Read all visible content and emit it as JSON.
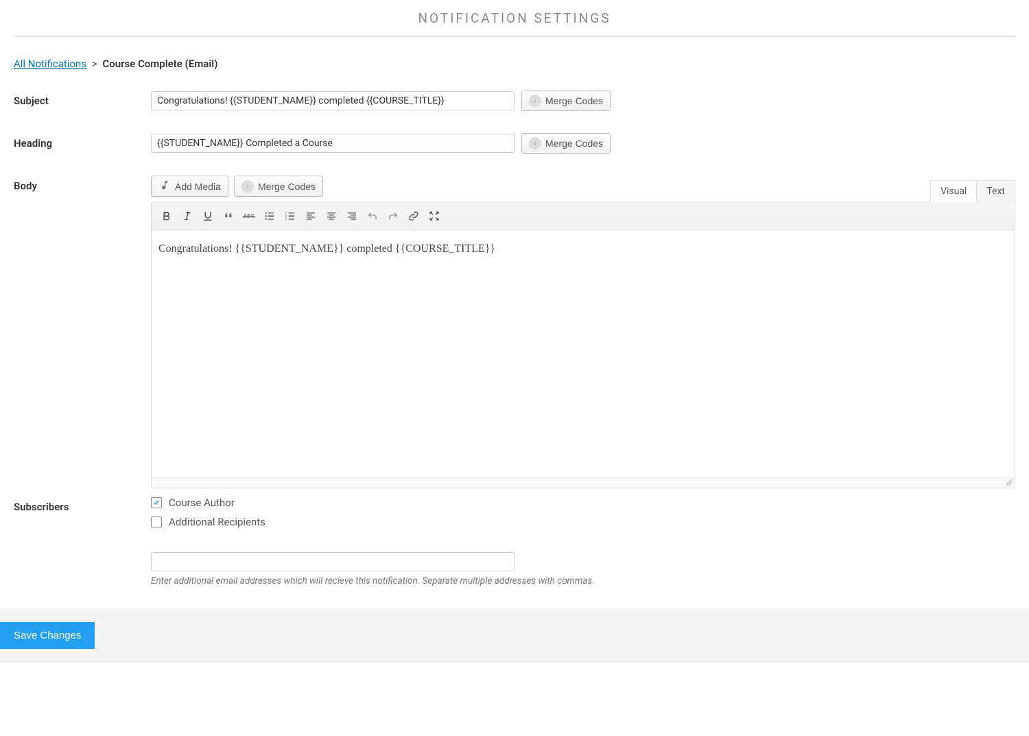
{
  "page_title": "NOTIFICATION SETTINGS",
  "breadcrumb": {
    "link_label": "All Notifications",
    "separator": ">",
    "current": "Course Complete (Email)"
  },
  "labels": {
    "subject": "Subject",
    "heading": "Heading",
    "body": "Body",
    "subscribers": "Subscribers"
  },
  "fields": {
    "subject_value": "Congratulations! {{STUDENT_NAME}} completed {{COURSE_TITLE}}",
    "heading_value": "{{STUDENT_NAME}} Completed a Course",
    "body_content": "Congratulations! {{STUDENT_NAME}} completed {{COURSE_TITLE}}",
    "additional_recipients_value": ""
  },
  "buttons": {
    "merge_codes": "Merge Codes",
    "add_media": "Add Media",
    "save": "Save Changes"
  },
  "tabs": {
    "visual": "Visual",
    "text": "Text"
  },
  "subscribers": {
    "course_author": {
      "label": "Course Author",
      "checked": true
    },
    "additional_recipients": {
      "label": "Additional Recipients",
      "checked": false
    },
    "help_text": "Enter additional email addresses which will recieve this notification. Separate multiple addresses with commas."
  }
}
